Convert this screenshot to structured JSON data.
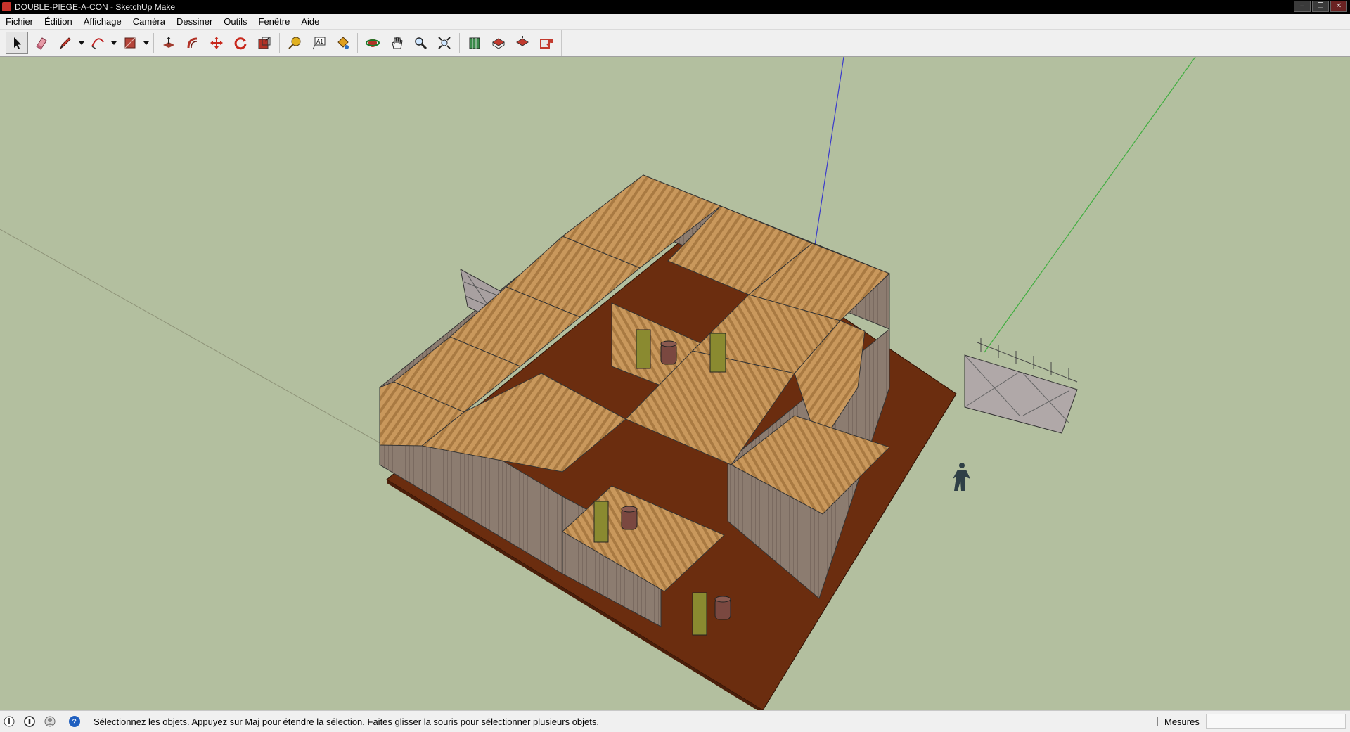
{
  "window": {
    "title": "DOUBLE-PIEGE-A-CON - SketchUp Make"
  },
  "menu": [
    {
      "label": "Fichier"
    },
    {
      "label": "Édition"
    },
    {
      "label": "Affichage"
    },
    {
      "label": "Caméra"
    },
    {
      "label": "Dessiner"
    },
    {
      "label": "Outils"
    },
    {
      "label": "Fenêtre"
    },
    {
      "label": "Aide"
    }
  ],
  "toolbar": {
    "tools": [
      "select-icon",
      "eraser-icon",
      "pencil-icon",
      "arc-icon",
      "rectangle-icon",
      "push-pull-icon",
      "follow-me-icon",
      "move-icon",
      "rotate-icon",
      "scale-icon",
      "tape-measure-icon",
      "text-icon",
      "paint-bucket-icon",
      "orbit-icon",
      "pan-icon",
      "zoom-icon",
      "zoom-extents-icon",
      "3d-warehouse-icon",
      "get-models-icon",
      "share-model-icon",
      "extension-icon"
    ],
    "active_tool": "select-icon"
  },
  "status": {
    "hint": "Sélectionnez les objets. Appuyez sur Maj pour étendre la sélection. Faites glisser la souris pour sélectionner plusieurs objets.",
    "measure_label": "Mesures",
    "measure_value": ""
  },
  "colors": {
    "viewport_bg": "#b3bf9f",
    "ground": "#6b2d0f",
    "roof": "#c9985c",
    "wall": "#8c7c70",
    "axis_blue": "#3a3acc",
    "axis_green": "#3fae3f"
  }
}
